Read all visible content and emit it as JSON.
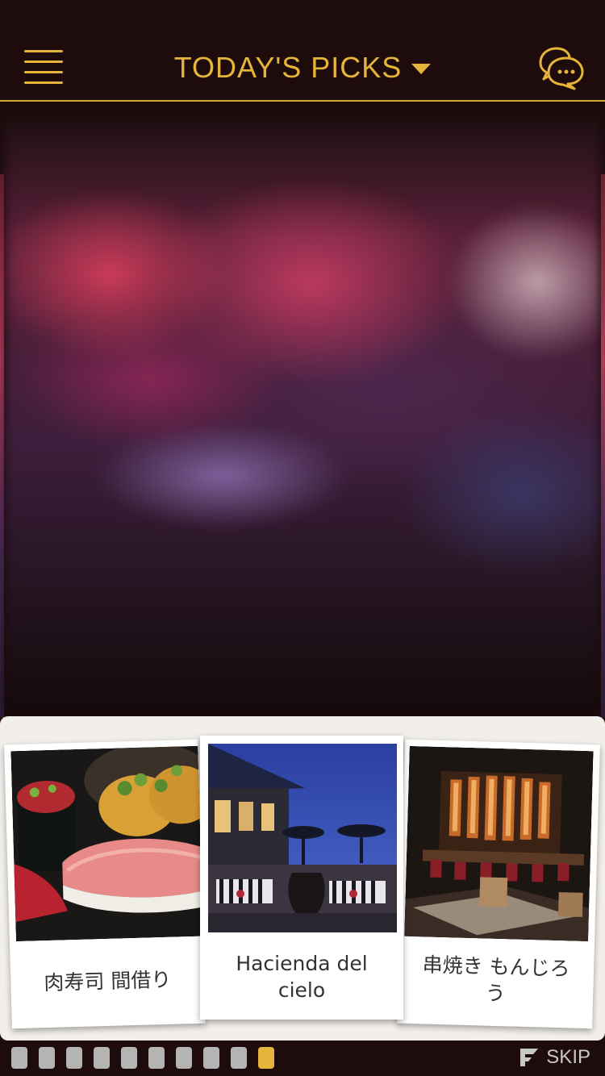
{
  "header": {
    "title": "TODAY'S PICKS",
    "accent_color": "#e5b43a",
    "menu_icon": "hamburger-menu-icon",
    "chat_icon": "chat-bubbles-icon"
  },
  "hero": {
    "image": "blurred featured photo"
  },
  "cards": [
    {
      "label": "肉寿司 間借り"
    },
    {
      "label": "Hacienda del cielo"
    },
    {
      "label": "串焼き もんじろう"
    }
  ],
  "pager": {
    "count": 10,
    "active_index": 9,
    "active_color": "#e5b43a"
  },
  "footer": {
    "skip_label": "SKIP"
  }
}
